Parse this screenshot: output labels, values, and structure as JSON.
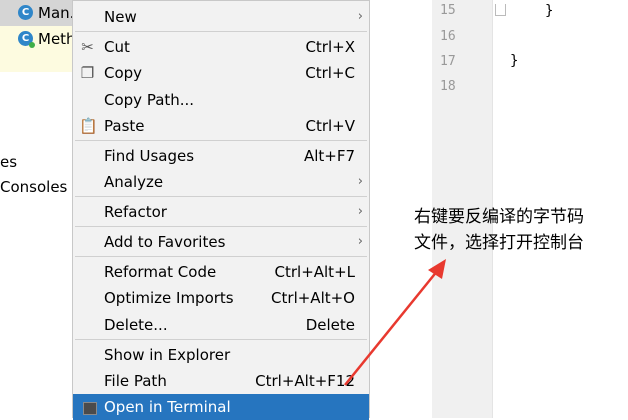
{
  "tree": {
    "row1_label": "Man.",
    "row2_label": "Meth",
    "side_a": "es",
    "side_b": "Consoles"
  },
  "editor": {
    "line_numbers": [
      "15",
      "16",
      "17",
      "18"
    ],
    "code_line_15": "}",
    "code_line_17": "}"
  },
  "menu": {
    "new": "New",
    "cut": "Cut",
    "cut_sc": "Ctrl+X",
    "copy": "Copy",
    "copy_sc": "Ctrl+C",
    "copy_path": "Copy Path...",
    "paste": "Paste",
    "paste_sc": "Ctrl+V",
    "find_usages": "Find Usages",
    "find_usages_sc": "Alt+F7",
    "analyze": "Analyze",
    "refactor": "Refactor",
    "add_favorites": "Add to Favorites",
    "reformat": "Reformat Code",
    "reformat_sc": "Ctrl+Alt+L",
    "optimize": "Optimize Imports",
    "optimize_sc": "Ctrl+Alt+O",
    "delete": "Delete...",
    "delete_sc": "Delete",
    "show_explorer": "Show in Explorer",
    "file_path": "File Path",
    "file_path_sc": "Ctrl+Alt+F12",
    "open_terminal": "Open in Terminal"
  },
  "annotation": {
    "line1": "右键要反编译的字节码",
    "line2": "文件，选择打开控制台"
  },
  "colors": {
    "selection": "#2675bf",
    "arrow": "#e8392f"
  }
}
